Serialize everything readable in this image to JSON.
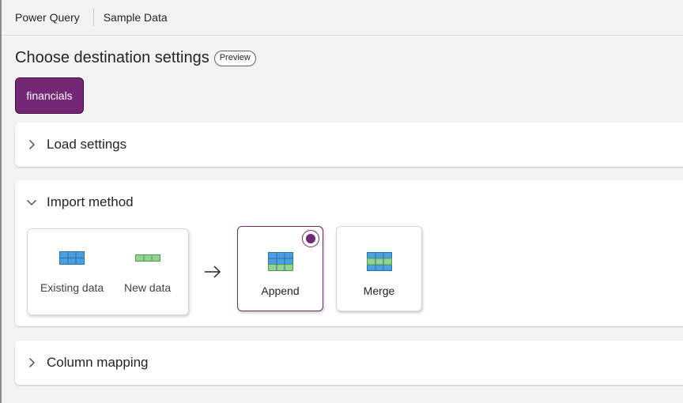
{
  "breadcrumb": {
    "app": "Power Query",
    "item": "Sample Data"
  },
  "page": {
    "title": "Choose destination settings",
    "badge": "Preview"
  },
  "query_tab": {
    "label": "financials"
  },
  "sections": {
    "load": {
      "label": "Load settings",
      "expanded": false
    },
    "import": {
      "label": "Import method",
      "expanded": true
    },
    "column": {
      "label": "Column mapping",
      "expanded": false
    }
  },
  "import_method": {
    "existing_label": "Existing data",
    "new_label": "New data",
    "options": [
      {
        "label": "Append",
        "selected": true,
        "icon": "append-table-icon"
      },
      {
        "label": "Merge",
        "selected": false,
        "icon": "merge-table-icon"
      }
    ]
  },
  "colors": {
    "accent": "#742774",
    "table_blue": "#4a9fe0",
    "table_green": "#92d38f"
  }
}
